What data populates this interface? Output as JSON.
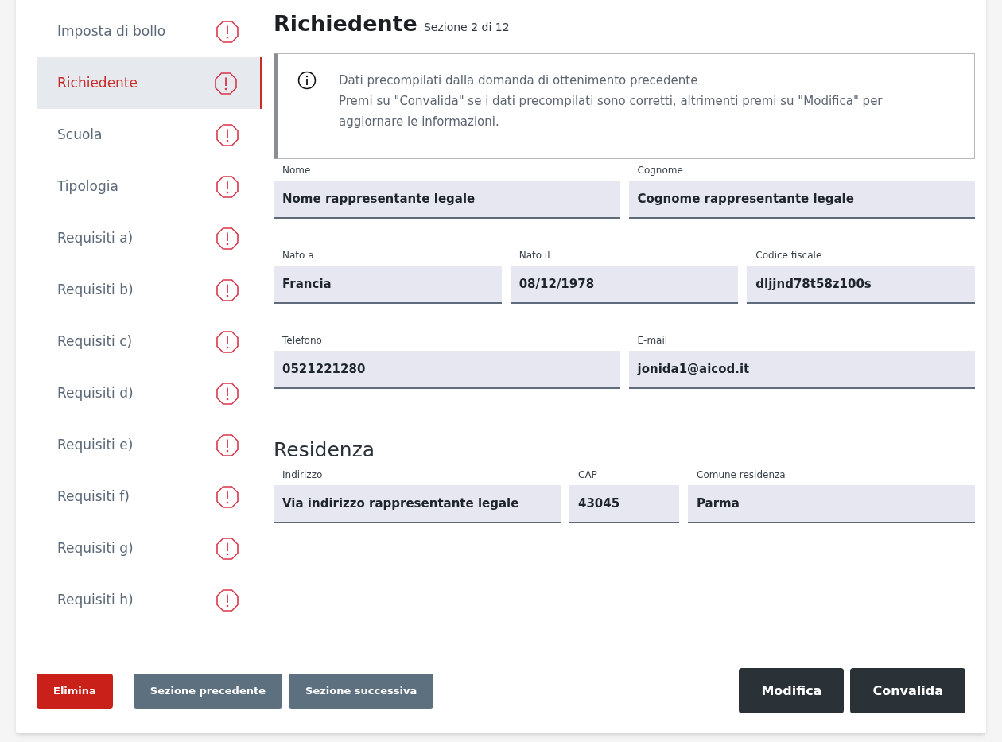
{
  "sidebar": {
    "items": [
      {
        "label": "Imposta di bollo",
        "selected": false
      },
      {
        "label": "Richiedente",
        "selected": true
      },
      {
        "label": "Scuola",
        "selected": false
      },
      {
        "label": "Tipologia",
        "selected": false
      },
      {
        "label": "Requisiti a)",
        "selected": false
      },
      {
        "label": "Requisiti b)",
        "selected": false
      },
      {
        "label": "Requisiti c)",
        "selected": false
      },
      {
        "label": "Requisiti d)",
        "selected": false
      },
      {
        "label": "Requisiti e)",
        "selected": false
      },
      {
        "label": "Requisiti f)",
        "selected": false
      },
      {
        "label": "Requisiti g)",
        "selected": false
      },
      {
        "label": "Requisiti h)",
        "selected": false
      }
    ]
  },
  "section": {
    "title": "Richiedente",
    "subtitle": "Sezione 2 di 12"
  },
  "notice": {
    "title": "Dati precompilati dalla domanda di ottenimento precedente",
    "text": "Premi su \"Convalida\" se i dati precompilati sono corretti, altrimenti premi su \"Modifica\" per aggiornare le informazioni."
  },
  "field_rows": [
    [
      {
        "label": "Nome",
        "value": "Nome rappresentante legale"
      },
      {
        "label": "Cognome",
        "value": "Cognome rappresentante legale"
      }
    ],
    [
      {
        "label": "Nato a",
        "value": "Francia"
      },
      {
        "label": "Nato il",
        "value": "08/12/1978"
      },
      {
        "label": "Codice fiscale",
        "value": "dljjnd78t58z100s"
      }
    ],
    [
      {
        "label": "Telefono",
        "value": "0521221280"
      },
      {
        "label": "E-mail",
        "value": "jonida1@aicod.it"
      }
    ]
  ],
  "residenza": {
    "heading": "Residenza",
    "fields": [
      {
        "label": "Indirizzo",
        "value": "Via indirizzo rappresentante legale"
      },
      {
        "label": "CAP",
        "value": "43045"
      },
      {
        "label": "Comune residenza",
        "value": "Parma"
      }
    ]
  },
  "footer": {
    "left_buttons": [
      {
        "label": "Elimina",
        "kind": "danger"
      },
      {
        "label": "Sezione precedente",
        "kind": "secondary"
      },
      {
        "label": "Sezione successiva",
        "kind": "secondary"
      }
    ],
    "right_buttons": [
      {
        "label": "Modifica",
        "kind": "primary"
      },
      {
        "label": "Convalida",
        "kind": "primary"
      }
    ]
  }
}
